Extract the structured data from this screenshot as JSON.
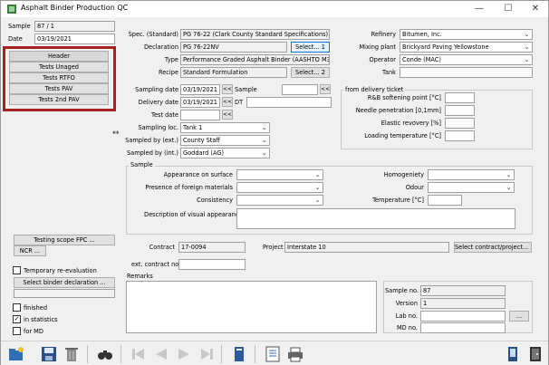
{
  "title": "Asphalt Binder Production QC",
  "sample": {
    "label": "Sample",
    "value": "87 / 1"
  },
  "date": {
    "label": "Date",
    "value": "03/19/2021"
  },
  "left_menu": [
    "Header",
    "Tests Unaged",
    "Tests RTFO",
    "Tests PAV",
    "Tests 2nd PAV"
  ],
  "left_buttons": {
    "testing_scope": "Testing scope FPC ...",
    "ncr": "NCR ..."
  },
  "temporary_reevaluation": "Temporary re-evaluation",
  "select_binder_declaration": "Select binder declaration ...",
  "checks": {
    "finished": "finished",
    "in_statistics": "in statistics",
    "for_md": "for MD"
  },
  "spec": {
    "label": "Spec. (Standard)",
    "value": "PG 76-22 (Clark County Standard Specifications)"
  },
  "declaration": {
    "label": "Declaration",
    "value": "PG 76-22NV",
    "button": "Select... 1"
  },
  "type": {
    "label": "Type",
    "value": "Performance Graded Asphalt Binder (AASHTO M332)"
  },
  "recipe": {
    "label": "Recipe",
    "value": "Standard Formulation",
    "button": "Select... 2"
  },
  "refinery": {
    "label": "Refinery",
    "value": "Bitumen, Inc."
  },
  "mixing_plant": {
    "label": "Mixing plant",
    "value": "Brickyard Paving Yellowstone"
  },
  "operator": {
    "label": "Operator",
    "value": "Conde (MAC)"
  },
  "tank": {
    "label": "Tank",
    "value": ""
  },
  "sampling_date": {
    "label": "Sampling date",
    "value": "03/19/2021",
    "sample_label": "Sample"
  },
  "delivery_date": {
    "label": "Delivery date",
    "value": "03/19/2021",
    "dt_label": "DT"
  },
  "test_date": {
    "label": "Test date",
    "value": ""
  },
  "sampling_loc": {
    "label": "Sampling loc.",
    "value": "Tank 1"
  },
  "sampled_by_ext": {
    "label": "Sampled by (ext.)",
    "value": "County Staff"
  },
  "sampled_by_int": {
    "label": "Sampled by (int.)",
    "value": "Goddard (AG)"
  },
  "delivery_ticket": {
    "title": "from delivery ticket",
    "rab": "R&B softening point [°C]",
    "needle": "Needle penetration [0,1mm]",
    "elastic": "Elastic revovery [%]",
    "loading": "Loading temperature [°C]"
  },
  "sample_group": {
    "title": "Sample",
    "appearance": "Appearance on surface",
    "foreign": "Presence of foreign materials",
    "consistency": "Consistency",
    "description": "Description of visual appearance",
    "homogeneity": "Homogeniety",
    "odour": "Odour",
    "temperature": "Temperature [°C]"
  },
  "contract": {
    "label": "Contract",
    "value": "17-0094"
  },
  "project": {
    "label": "Project",
    "value": "Interstate 10",
    "button": "Select contract/project... 2"
  },
  "ext_contract": {
    "label": "ext. contract no.",
    "value": ""
  },
  "remarks": {
    "label": "Remarks"
  },
  "sample_no": {
    "label": "Sample no.",
    "value": "87"
  },
  "version": {
    "label": "Version",
    "value": "1"
  },
  "lab_no": {
    "label": "Lab no.",
    "value": "",
    "button": "..."
  },
  "md_no": {
    "label": "MD no.",
    "value": ""
  },
  "arrow_btn": "<<"
}
